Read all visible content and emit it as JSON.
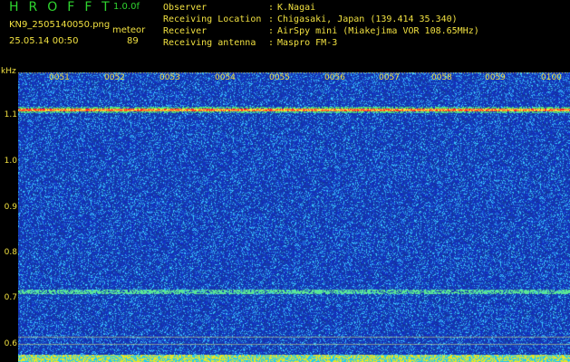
{
  "header": {
    "logo": "HROFFT",
    "version": "1.0.0f",
    "filename": "KN9_2505140050.png",
    "timestamp": "25.05.14 00:50",
    "meteor_label": "meteor",
    "meteor_count": "89"
  },
  "info": [
    {
      "key": "Observer",
      "value": "K.Nagai"
    },
    {
      "key": "Receiving Location",
      "value": "Chigasaki, Japan (139.414 35.340)"
    },
    {
      "key": "Receiver",
      "value": "AirSpy mini (Miakejima VOR 108.65MHz)"
    },
    {
      "key": "Receiving antenna",
      "value": "Maspro FM-3"
    }
  ],
  "axis": {
    "unit": "kHz",
    "y_ticks": [
      "1.1",
      "1.0",
      "0.9",
      "0.8",
      "0.7",
      "0.6"
    ],
    "x_ticks": [
      "0051",
      "0052",
      "0053",
      "0054",
      "0055",
      "0056",
      "0057",
      "0058",
      "0059",
      "0100"
    ]
  },
  "colors": {
    "background": "#000000",
    "label": "#f0e040",
    "logo": "#2fd52f",
    "spectrum_base": "#1a2fb0",
    "carrier_line": "#ff3030"
  }
}
